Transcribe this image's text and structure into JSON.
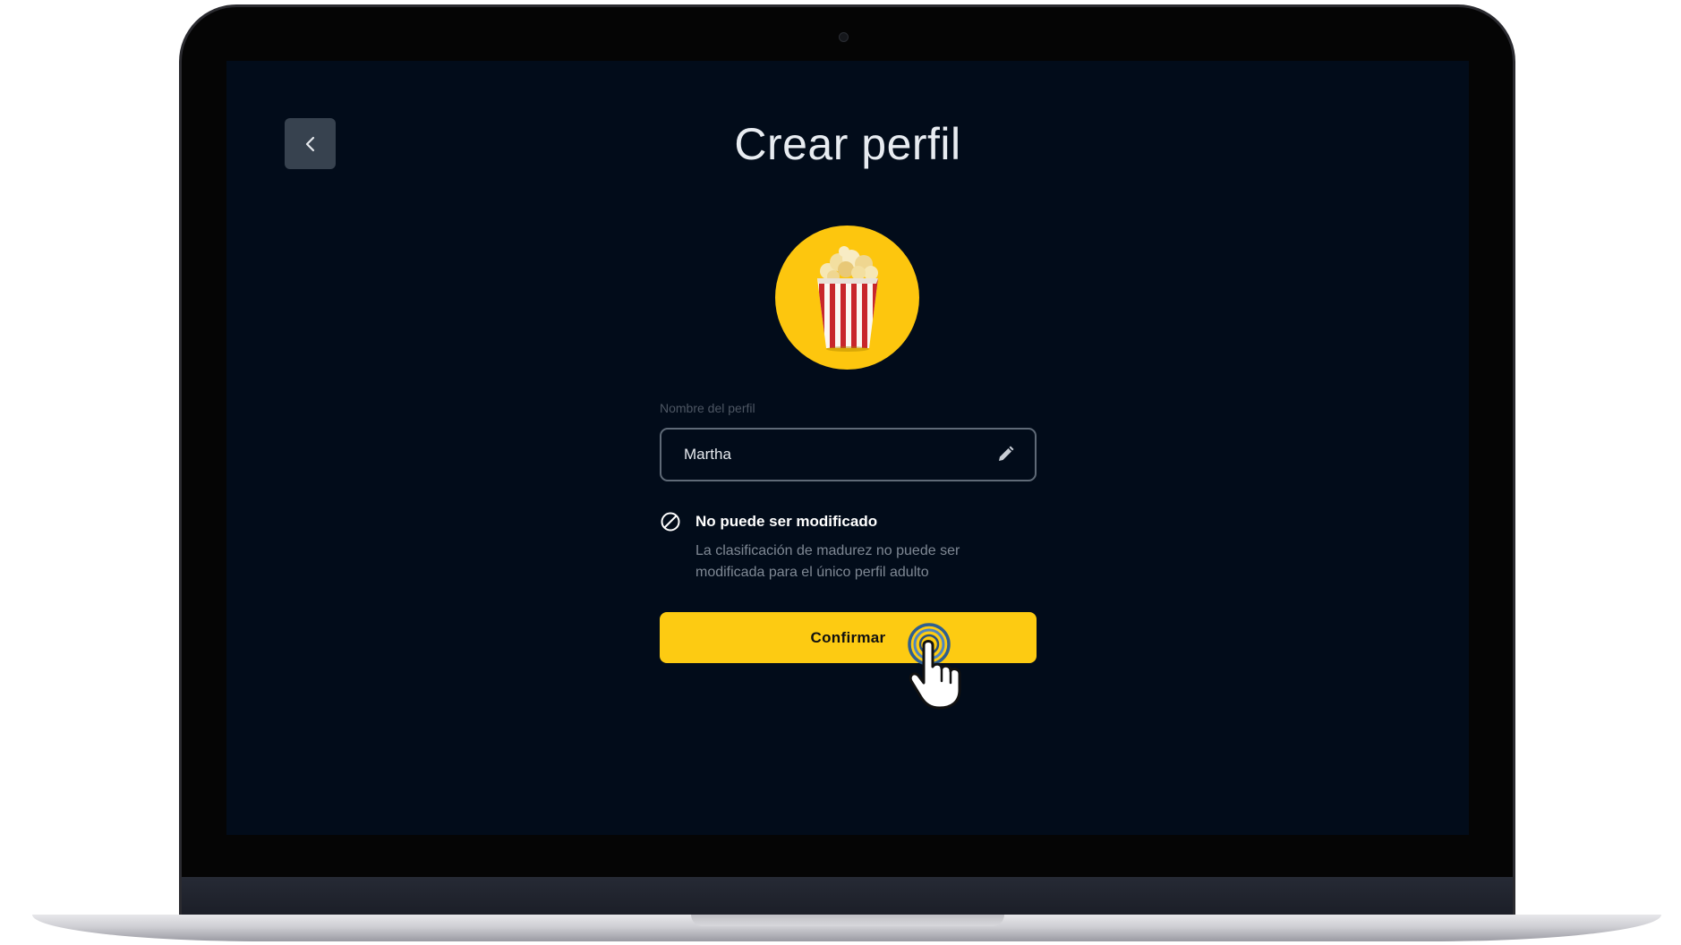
{
  "screen": {
    "title": "Crear perfil",
    "back_button": {
      "icon": "chevron-left-icon"
    },
    "avatar": {
      "icon": "popcorn-icon",
      "background": "#fdc60e"
    },
    "profile_name": {
      "label": "Nombre del perfil",
      "value": "Martha",
      "edit_icon": "pencil-icon"
    },
    "notice": {
      "icon": "no-entry-icon",
      "title": "No puede ser modificado",
      "description": "La clasificación de madurez no puede ser modificada para el único perfil adulto"
    },
    "confirm_button": {
      "label": "Confirmar",
      "color": "#fdcb12"
    }
  },
  "colors": {
    "screen_background": "#020c1a",
    "accent": "#fdcb12",
    "back_button_bg": "#37424f"
  }
}
